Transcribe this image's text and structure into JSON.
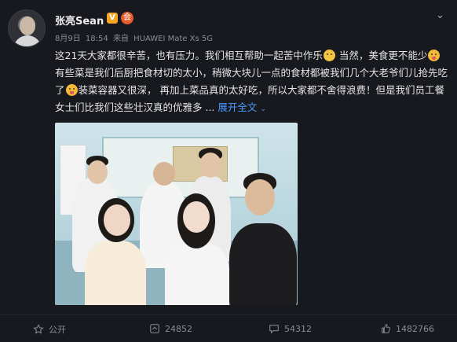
{
  "user": {
    "name": "张亮Sean",
    "verified_badge": "V",
    "member_badge": "会"
  },
  "meta": {
    "date": "8月9日",
    "time": "18:54",
    "source_prefix": "来自",
    "device": "HUAWEI Mate Xs 5G"
  },
  "post": {
    "part1": "这21天大家都很辛苦，也有压力。我们相互帮助一起苦中作乐",
    "part2": " 当然，美食更不能少",
    "part3": " 有些菜是我们后厨把食材切的太小，稍微大块儿一点的食材都被我们几个大老爷们儿抢先吃了",
    "part4": "装菜容器又很深，  再加上菜品真的太好吃，所以大家都不舍得浪费！但是我们员工餐女士们比我们这些壮汉真的优雅多 ...",
    "expand_label": "展开全文",
    "expand_arrow": "⌄"
  },
  "actions": {
    "forward": "公开",
    "reposts": "24852",
    "comments": "54312",
    "likes": "1482766"
  },
  "icons": {
    "star": "star-icon",
    "repost": "repost-icon",
    "comment": "comment-icon",
    "like": "like-icon",
    "chevron": "chevron-down-icon"
  },
  "colors": {
    "link": "#4a9bff",
    "badge": "#f5a623"
  }
}
